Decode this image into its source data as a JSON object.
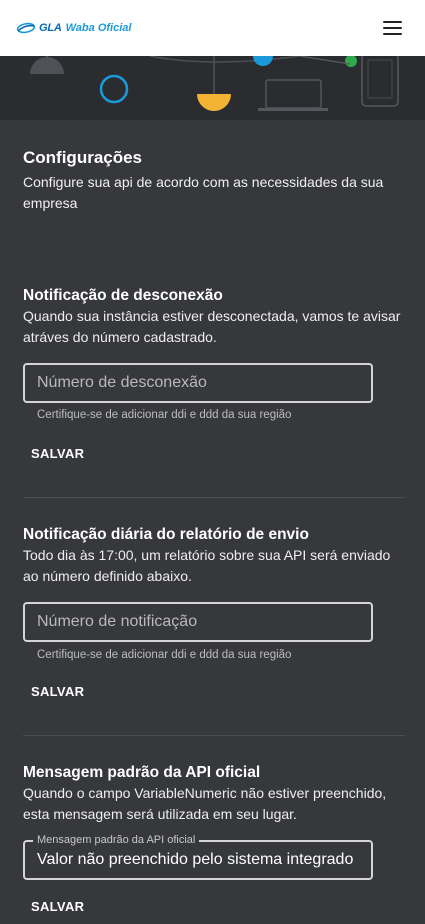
{
  "header": {
    "logo_text": "GLA",
    "logo_subtitle": "Waba Oficial",
    "menu_icon": "hamburger-menu-icon"
  },
  "page": {
    "title": "Configurações",
    "subtitle": "Configure sua api de acordo com as necessidades da sua empresa"
  },
  "sections": [
    {
      "title": "Notificação de desconexão",
      "description": "Quando sua instância estiver desconectada, vamos te avisar atráves do número cadastrado.",
      "input_placeholder": "Número de desconexão",
      "input_value": "",
      "helper": "Certifique-se de adicionar ddi e ddd da sua região",
      "save_label": "SALVAR"
    },
    {
      "title": "Notificação diária do relatório de envio",
      "description": "Todo dia às 17:00, um relatório sobre sua API será enviado ao número definido abaixo.",
      "input_placeholder": "Número de notificação",
      "input_value": "",
      "helper": "Certifique-se de adicionar ddi e ddd da sua região",
      "save_label": "SALVAR"
    },
    {
      "title": "Mensagem padrão da API oficial",
      "description": "Quando o campo VariableNumeric não estiver preenchido, esta mensagem será utilizada em seu lugar.",
      "input_label": "Mensagem padrão da API oficial",
      "input_value": "Valor não preenchido pelo sistema integrado",
      "save_label": "SALVAR"
    }
  ],
  "colors": {
    "background": "#37383c",
    "header": "#ffffff",
    "banner": "#2b2c30",
    "accent_blue": "#1a9ad9",
    "accent_yellow": "#f2b233",
    "accent_green": "#2fa84f"
  }
}
